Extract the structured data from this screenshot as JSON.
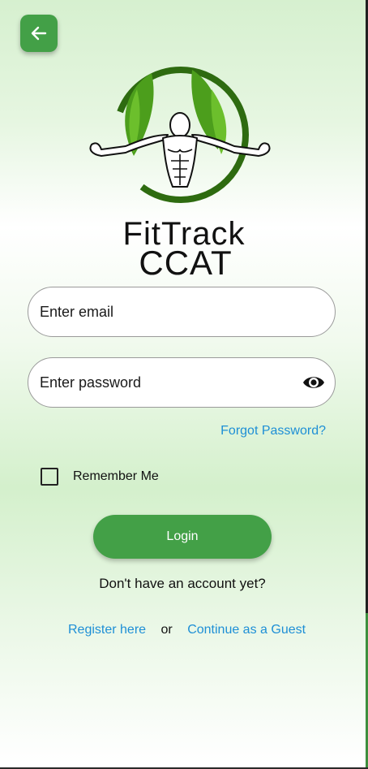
{
  "header": {
    "back_icon": "arrow-left-icon"
  },
  "brand": {
    "logo_icon": "fittrack-muscle-leaf-logo",
    "line1": "FitTrack",
    "line2": "CCAT"
  },
  "form": {
    "email_placeholder": "Enter email",
    "email_value": "",
    "password_placeholder": "Enter password",
    "password_value": "",
    "password_toggle_icon": "eye-icon",
    "forgot_password": "Forgot Password?",
    "remember_me": "Remember Me",
    "remember_checked": false,
    "login_label": "Login"
  },
  "footer": {
    "no_account": "Don't have an account yet?",
    "register": "Register here",
    "or": "or",
    "guest": "Continue as a Guest"
  },
  "colors": {
    "primary": "#43a047",
    "link": "#1e8fd6",
    "leaf_green": "#4c9e1c",
    "ring_green": "#2e6b10"
  }
}
